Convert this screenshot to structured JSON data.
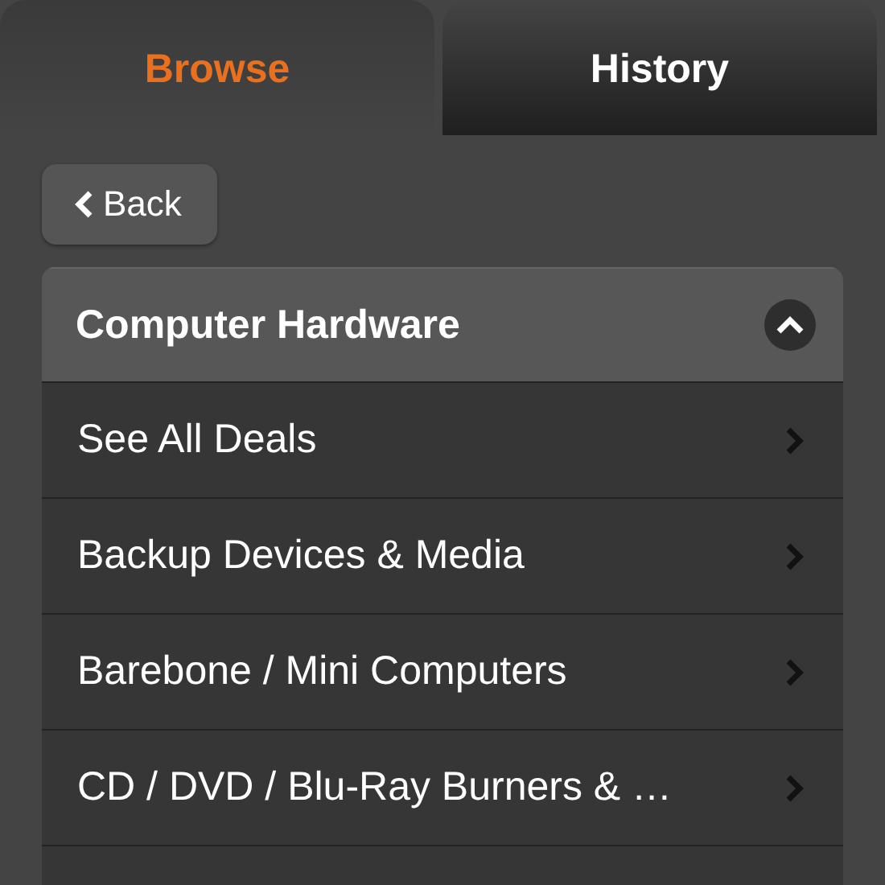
{
  "tabs": [
    {
      "label": "Browse",
      "selected": true
    },
    {
      "label": "History",
      "selected": false
    }
  ],
  "back_button": {
    "label": "Back"
  },
  "category": {
    "title": "Computer Hardware",
    "expanded": true
  },
  "items": [
    {
      "label": "See All Deals"
    },
    {
      "label": "Backup Devices & Media"
    },
    {
      "label": "Barebone / Mini Computers"
    },
    {
      "label": "CD / DVD / Blu-Ray Burners & …"
    }
  ]
}
